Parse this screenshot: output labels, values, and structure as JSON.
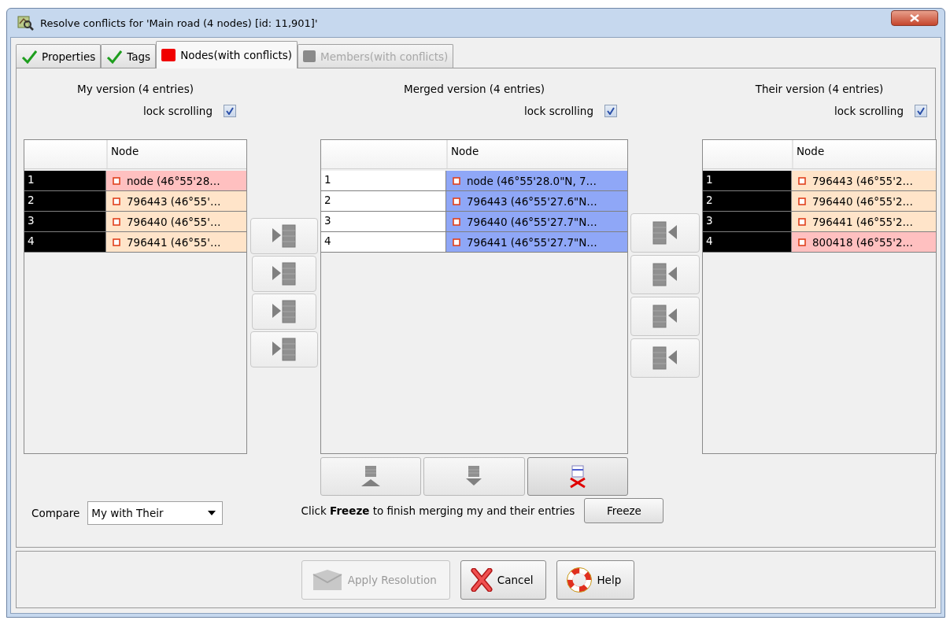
{
  "window": {
    "title": "Resolve conflicts for 'Main road (4 nodes) [id: 11,901]'"
  },
  "tabs": [
    {
      "label": "Properties",
      "kind": "resolved",
      "selected": false,
      "disabled": false
    },
    {
      "label": "Tags",
      "kind": "resolved",
      "selected": false,
      "disabled": false
    },
    {
      "label": "Nodes(with conflicts)",
      "kind": "conflict",
      "selected": true,
      "disabled": false
    },
    {
      "label": "Members(with conflicts)",
      "kind": "inactive",
      "selected": false,
      "disabled": true
    }
  ],
  "panes": [
    {
      "kind": "source",
      "title": "My version (4 entries)",
      "lock_label": "lock scrolling",
      "lock_checked": true,
      "column_header": "Node",
      "rows": [
        {
          "index": "1",
          "node": "node (46°55'28…",
          "color": "#ffc0c0"
        },
        {
          "index": "2",
          "node": "796443 (46°55'…",
          "color": "#ffe4c9"
        },
        {
          "index": "3",
          "node": "796440 (46°55'…",
          "color": "#ffe4c9"
        },
        {
          "index": "4",
          "node": "796441 (46°55'…",
          "color": "#ffe4c9"
        }
      ]
    },
    {
      "kind": "merged",
      "title": "Merged version (4 entries)",
      "lock_label": "lock scrolling",
      "lock_checked": true,
      "column_header": "Node",
      "rows": [
        {
          "index": "1",
          "node": "node (46°55'28.0\"N, 7…",
          "color": "#8fa7f7"
        },
        {
          "index": "2",
          "node": "796443 (46°55'27.6\"N…",
          "color": "#8fa7f7"
        },
        {
          "index": "3",
          "node": "796440 (46°55'27.7\"N…",
          "color": "#8fa7f7"
        },
        {
          "index": "4",
          "node": "796441 (46°55'27.7\"N…",
          "color": "#8fa7f7"
        }
      ]
    },
    {
      "kind": "source",
      "title": "Their version (4 entries)",
      "lock_label": "lock scrolling",
      "lock_checked": true,
      "column_header": "Node",
      "rows": [
        {
          "index": "1",
          "node": "796443 (46°55'2…",
          "color": "#ffe4c9"
        },
        {
          "index": "2",
          "node": "796440 (46°55'2…",
          "color": "#ffe4c9"
        },
        {
          "index": "3",
          "node": "796441 (46°55'2…",
          "color": "#ffe4c9"
        },
        {
          "index": "4",
          "node": "800418 (46°55'2…",
          "color": "#ffc0c0"
        }
      ]
    }
  ],
  "compare": {
    "label": "Compare",
    "value": "My with Their"
  },
  "freeze": {
    "text": "Click **Freeze** to finish merging my and their entries",
    "button": "Freeze"
  },
  "footer_buttons": [
    {
      "label": "Apply Resolution",
      "kind": "apply",
      "disabled": true
    },
    {
      "label": "Cancel",
      "kind": "cancel",
      "disabled": false
    },
    {
      "label": "Help",
      "kind": "help",
      "disabled": false
    }
  ]
}
